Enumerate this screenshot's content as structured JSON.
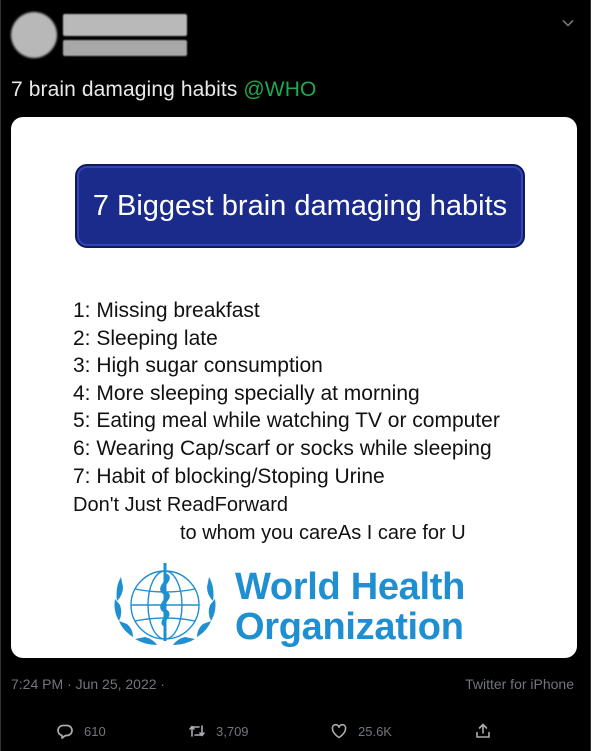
{
  "tweet": {
    "text": "7 brain damaging habits",
    "mention": "@WHO",
    "timestamp": "7:24 PM · Jun 25, 2022 ·",
    "source": "Twitter for iPhone"
  },
  "image": {
    "banner": "7 Biggest brain damaging habits",
    "habits": [
      "1: Missing breakfast",
      "2: Sleeping late",
      "3: High sugar consumption",
      "4: More sleeping specially at morning",
      "5: Eating meal while watching TV or computer",
      "6: Wearing Cap/scarf or socks while sleeping",
      "7: Habit of blocking/Stoping Urine"
    ],
    "closing_line1": "Don't Just ReadForward",
    "closing_line2": "to whom you careAs I care for U",
    "org_line1": "World Health",
    "org_line2": "Organization"
  },
  "actions": {
    "replies": "610",
    "retweets": "3,709",
    "likes": "25.6K"
  },
  "colors": {
    "background": "#000000",
    "mention": "#1da851",
    "banner": "#1a2b8c",
    "who_blue": "#1f8fd2"
  },
  "icons": [
    "chevron-down-icon",
    "reply-icon",
    "retweet-icon",
    "like-icon",
    "share-icon"
  ]
}
